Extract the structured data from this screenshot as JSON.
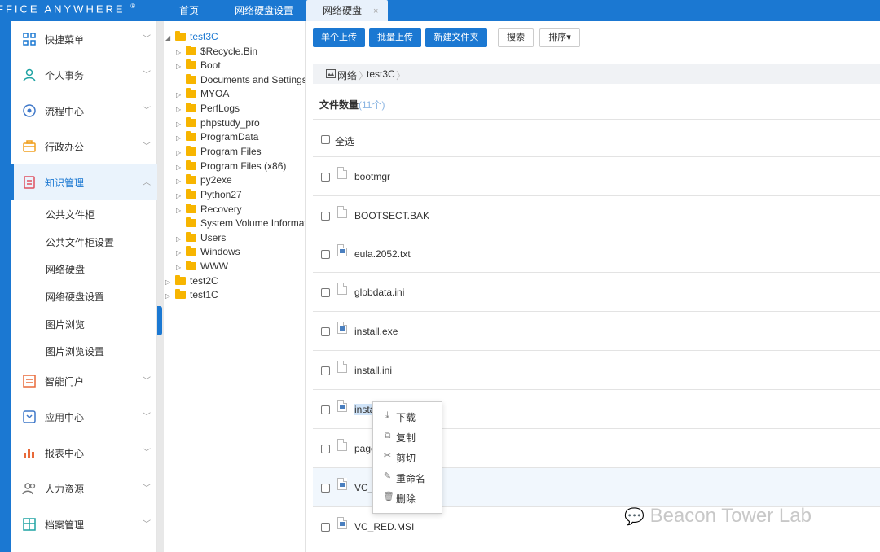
{
  "brand": {
    "logo_text": "FFICE ANYWHERE",
    "logo_mark": "®"
  },
  "nav_tabs": [
    {
      "label": "首页"
    },
    {
      "label": "网络硬盘设置"
    },
    {
      "label": "网络硬盘",
      "close": "×"
    }
  ],
  "sidebar": {
    "menus": [
      {
        "label": "快捷菜单",
        "icon": "grid-icon"
      },
      {
        "label": "个人事务",
        "icon": "user-icon"
      },
      {
        "label": "流程中心",
        "icon": "flow-icon"
      },
      {
        "label": "行政办公",
        "icon": "briefcase-icon"
      },
      {
        "label": "知识管理",
        "icon": "book-icon"
      },
      {
        "label": "智能门户",
        "icon": "portal-icon"
      },
      {
        "label": "应用中心",
        "icon": "app-icon"
      },
      {
        "label": "报表中心",
        "icon": "chart-icon"
      },
      {
        "label": "人力资源",
        "icon": "people-icon"
      },
      {
        "label": "档案管理",
        "icon": "archive-icon"
      }
    ],
    "submenu": [
      "公共文件柜",
      "公共文件柜设置",
      "网络硬盘",
      "网络硬盘设置",
      "图片浏览",
      "图片浏览设置"
    ],
    "accent": "#1b78d2"
  },
  "tree": {
    "root": "test3C",
    "children": [
      "$Recycle.Bin",
      "Boot",
      "Documents and Settings",
      "MYOA",
      "PerfLogs",
      "phpstudy_pro",
      "ProgramData",
      "Program Files",
      "Program Files (x86)",
      "py2exe",
      "Python27",
      "Recovery",
      "System Volume Information",
      "Users",
      "Windows",
      "WWW"
    ],
    "siblings": [
      "test2C",
      "test1C"
    ]
  },
  "toolbar": {
    "upload_single": "单个上传",
    "upload_batch": "批量上传",
    "new_folder": "新建文件夹",
    "search": "搜索",
    "sort": "排序▾"
  },
  "breadcrumb": {
    "root": "网络",
    "current": "test3C"
  },
  "file_count": {
    "label": "文件数量",
    "count": "(11个)"
  },
  "select_all": "全选",
  "files": [
    {
      "name": "bootmgr"
    },
    {
      "name": "BOOTSECT.BAK"
    },
    {
      "name": "eula.2052.txt"
    },
    {
      "name": "globdata.ini"
    },
    {
      "name": "install.exe"
    },
    {
      "name": "install.ini"
    },
    {
      "name": "insta"
    },
    {
      "name": "page"
    },
    {
      "name": "VC_"
    },
    {
      "name": "VC_RED.MSI"
    }
  ],
  "context_menu": [
    {
      "label": "下载",
      "icon": "download-icon"
    },
    {
      "label": "复制",
      "icon": "copy-icon"
    },
    {
      "label": "剪切",
      "icon": "cut-icon"
    },
    {
      "label": "重命名",
      "icon": "rename-icon"
    },
    {
      "label": "删除",
      "icon": "delete-icon"
    }
  ],
  "watermark": "Beacon Tower Lab"
}
